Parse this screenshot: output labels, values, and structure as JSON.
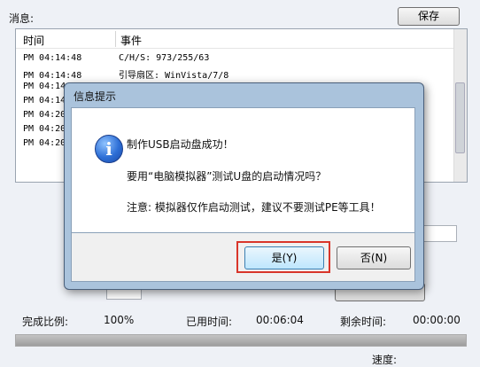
{
  "window": {
    "messages_label": "消息:",
    "save_label": "保存"
  },
  "log": {
    "columns": [
      "时间",
      "事件"
    ],
    "rows": [
      {
        "time": "PM 04:14:48",
        "event": "C/H/S: 973/255/63"
      },
      {
        "time": "PM 04:14:48",
        "event": "引导扇区: WinVista/7/8"
      },
      {
        "time": "PM 04:14",
        "event": ""
      },
      {
        "time": "PM 04:14",
        "event": ""
      },
      {
        "time": "PM 04:20",
        "event": ""
      },
      {
        "time": "PM 04:20",
        "event": ""
      },
      {
        "time": "PM 04:20",
        "event": ""
      }
    ]
  },
  "status": {
    "completion_label": "完成比例:",
    "completion_value": "100%",
    "elapsed_label": "已用时间:",
    "elapsed_value": "00:06:04",
    "remaining_label": "剩余时间:",
    "remaining_value": "00:00:00",
    "progress_percent": 100,
    "speed_label": "速度:"
  },
  "dialog": {
    "title": "信息提示",
    "icon": "info-icon",
    "message_line1": "制作USB启动盘成功！",
    "message_line2": "要用“电脑模拟器”测试U盘的启动情况吗？",
    "message_line3": "注意: 模拟器仅作启动测试，建议不要测试PE等工具！",
    "yes_label": "是(Y)",
    "no_label": "否(N)"
  },
  "colors": {
    "highlight": "#d9352a",
    "dialog_frame": "#aac3dc"
  }
}
